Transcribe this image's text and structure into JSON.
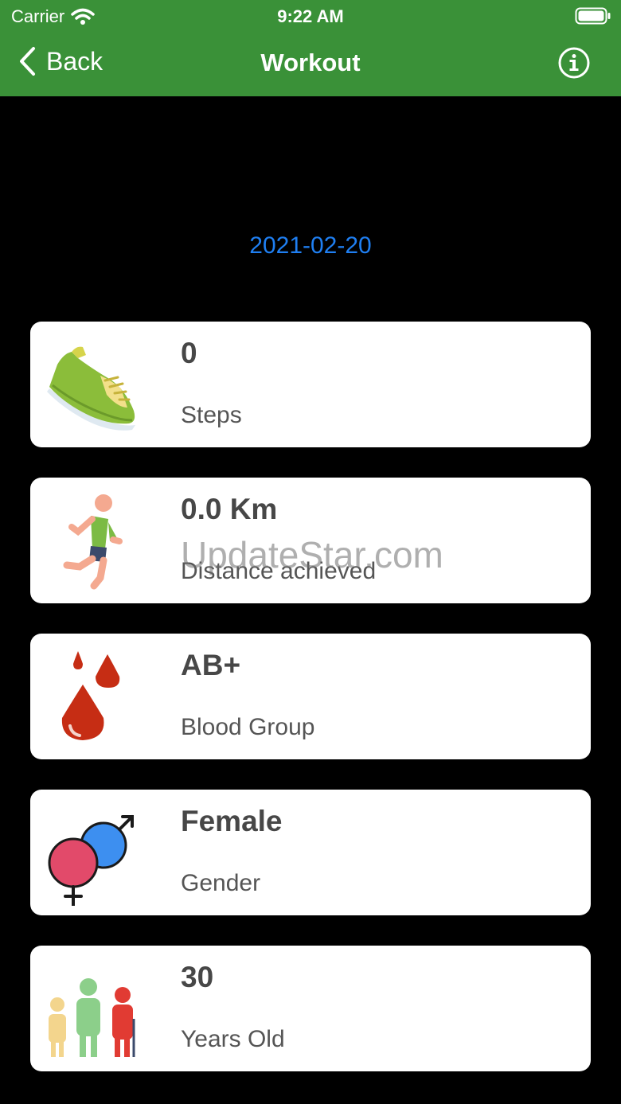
{
  "status_bar": {
    "carrier": "Carrier",
    "time": "9:22 AM"
  },
  "nav": {
    "back_label": "Back",
    "title": "Workout",
    "info_icon": "info-icon"
  },
  "date": "2021-02-20",
  "cards": [
    {
      "icon": "shoe-icon",
      "value": "0",
      "label": "Steps"
    },
    {
      "icon": "runner-icon",
      "value": "0.0 Km",
      "label": "Distance achieved"
    },
    {
      "icon": "blood-drops-icon",
      "value": "AB+",
      "label": "Blood Group"
    },
    {
      "icon": "gender-symbols-icon",
      "value": "Female",
      "label": "Gender"
    },
    {
      "icon": "people-ages-icon",
      "value": "30",
      "label": "Years Old"
    }
  ],
  "watermark": "UpdateStar.com",
  "colors": {
    "header": "#3a9138",
    "date": "#1f7ff2",
    "background": "#000000"
  }
}
